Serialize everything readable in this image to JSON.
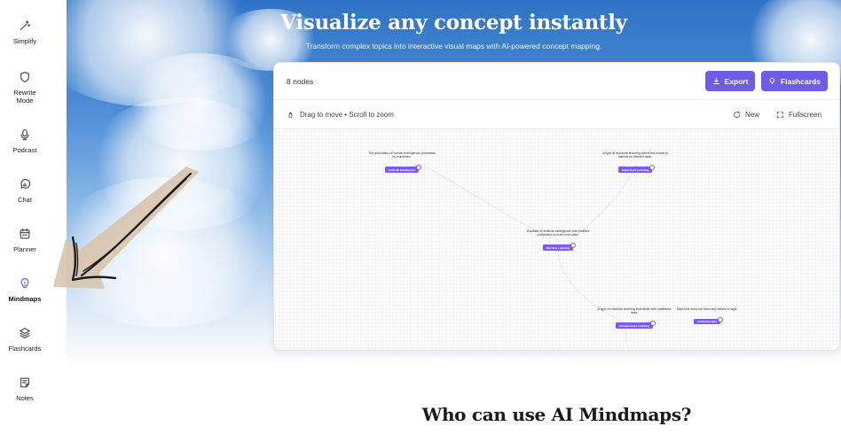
{
  "sidebar": {
    "items": [
      {
        "label": "Simplify",
        "icon": "sparkle-wand-icon"
      },
      {
        "label": "Rewrite Mode",
        "icon": "shield-icon"
      },
      {
        "label": "Podcast",
        "icon": "microphone-icon"
      },
      {
        "label": "Chat",
        "icon": "chat-bubble-icon"
      },
      {
        "label": "Planner",
        "icon": "calendar-icon"
      },
      {
        "label": "Mindmaps",
        "icon": "lightbulb-icon",
        "active": true
      },
      {
        "label": "Flashcards",
        "icon": "layers-icon"
      },
      {
        "label": "Notes",
        "icon": "note-icon"
      }
    ]
  },
  "hero": {
    "title": "Visualize any concept instantly",
    "subtitle": "Transform complex topics into interactive visual maps with AI-powered concept mapping."
  },
  "panel": {
    "node_count": "8 nodes",
    "export_label": "Export",
    "flashcards_label": "Flashcards",
    "hint": "Drag to move • Scroll to zoom",
    "new_label": "New",
    "fullscreen_label": "Fullscreen",
    "nodes": [
      {
        "desc": "The simulation of human intelligence processes by machines.",
        "label": "Artificial Intelligence"
      },
      {
        "desc": "A type of machine learning where the model is trained on labeled data.",
        "label": "Supervised Learning"
      },
      {
        "desc": "A subset of artificial intelligence that enables computers to learn from data.",
        "label": "Machine Learning"
      },
      {
        "desc": "A type of machine learning that deals with unlabeled data.",
        "label": "Unsupervised Learning"
      },
      {
        "desc": "Data that does not have any labels or tags.",
        "label": "Unlabeled Data"
      }
    ]
  },
  "section": {
    "title": "Who can use AI Mindmaps?"
  },
  "colors": {
    "accent": "#6d5ce8",
    "node": "#7c5cf0",
    "sky": "#4d8ed6"
  }
}
